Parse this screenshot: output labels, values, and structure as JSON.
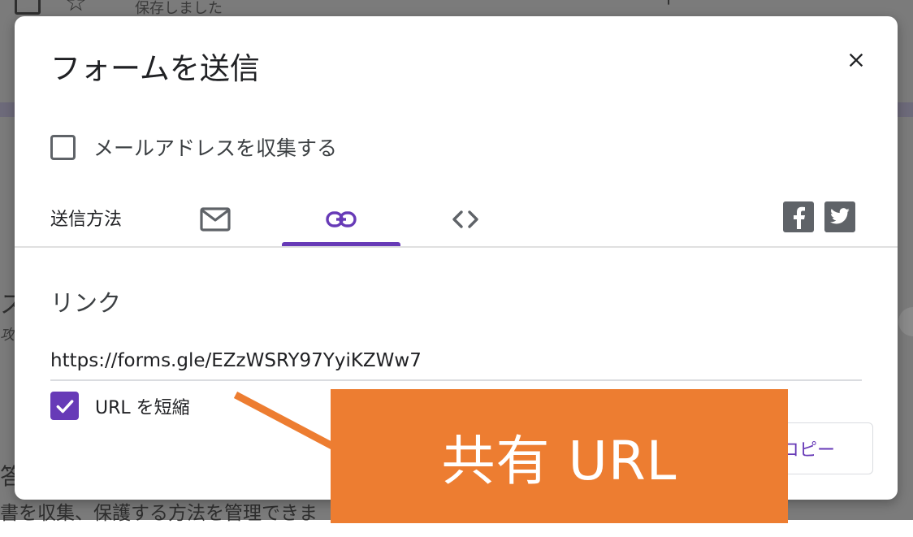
{
  "background": {
    "saved_text": "保存しました",
    "side_char_1": "ス",
    "side_char_2": "攻の",
    "side_char_3": "答",
    "bottom_text": "書を収集、保護する方法を管理できま"
  },
  "dialog": {
    "title": "フォームを送信",
    "close_icon": "close-icon",
    "collect_email_label": "メールアドレスを収集する",
    "collect_email_checked": false,
    "send_method_label": "送信方法",
    "tabs": [
      {
        "name": "email",
        "icon": "mail-icon",
        "selected": false
      },
      {
        "name": "link",
        "icon": "link-icon",
        "selected": true
      },
      {
        "name": "embed",
        "icon": "code-icon",
        "selected": false
      }
    ],
    "social": [
      {
        "name": "facebook",
        "icon": "facebook-icon"
      },
      {
        "name": "twitter",
        "icon": "twitter-icon"
      }
    ],
    "link_heading": "リンク",
    "url_value": "https://forms.gle/EZzWSRY97YyiKZWw7",
    "shorten_label": "URL を短縮",
    "shorten_checked": true,
    "copy_label": "コピー"
  },
  "annotation": {
    "label": "共有 URL",
    "color": "#ed7d31"
  },
  "colors": {
    "accent": "#673ab7",
    "icon_gray": "#5f6368"
  }
}
